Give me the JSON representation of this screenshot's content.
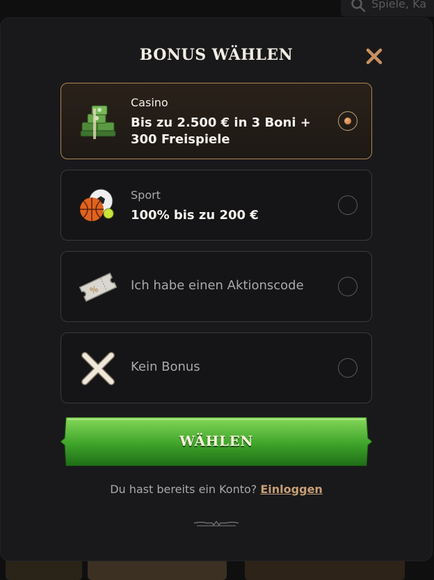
{
  "background": {
    "search_placeholder": "Spiele, Ka"
  },
  "modal": {
    "title": "BONUS WÄHLEN",
    "options": [
      {
        "category": "Casino",
        "title": "Bis zu 2.500 € in 3 Boni + 300 Freispiele",
        "icon": "money-stack-icon",
        "selected": true
      },
      {
        "category": "Sport",
        "title": "100% bis zu 200 €",
        "icon": "sports-balls-icon",
        "selected": false
      },
      {
        "label": "Ich habe einen Aktionscode",
        "icon": "ticket-icon",
        "selected": false
      },
      {
        "label": "Kein Bonus",
        "icon": "cross-icon",
        "selected": false
      }
    ],
    "choose_button": "WÄHLEN",
    "login_prompt": "Du hast bereits ein Konto?",
    "login_link": "Einloggen"
  },
  "colors": {
    "accent_border": "#b08656",
    "button_green": "#3da52a",
    "link": "#c89f75",
    "close_icon": "#c89062"
  }
}
